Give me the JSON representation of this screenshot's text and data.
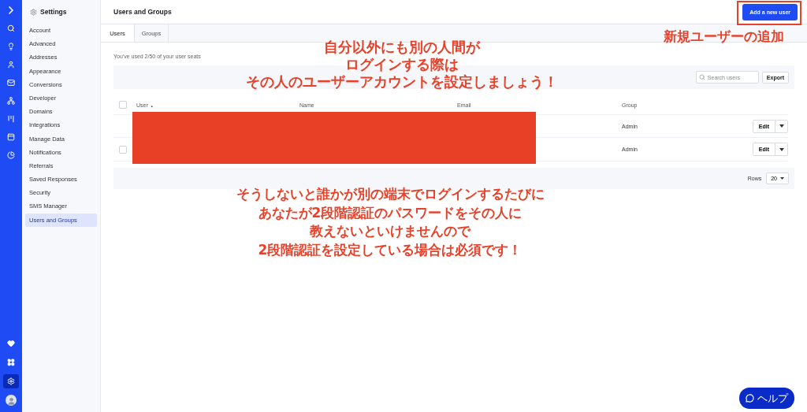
{
  "rail": {
    "icons": [
      {
        "kind": "logo"
      },
      {
        "kind": "search"
      },
      {
        "kind": "bulb"
      },
      {
        "kind": "person"
      },
      {
        "kind": "mail"
      },
      {
        "kind": "sitemap"
      },
      {
        "kind": "kanban"
      },
      {
        "kind": "window"
      },
      {
        "kind": "pie"
      }
    ],
    "bottom_icons": [
      {
        "kind": "heart",
        "selected": false
      },
      {
        "kind": "grid",
        "selected": false
      },
      {
        "kind": "gear",
        "selected": true
      },
      {
        "kind": "avatar",
        "selected": false
      }
    ]
  },
  "sidebar": {
    "title": "Settings",
    "items": [
      {
        "label": "Account",
        "selected": false
      },
      {
        "label": "Advanced",
        "selected": false
      },
      {
        "label": "Addresses",
        "selected": false
      },
      {
        "label": "Appearance",
        "selected": false
      },
      {
        "label": "Conversions",
        "selected": false
      },
      {
        "label": "Developer",
        "selected": false
      },
      {
        "label": "Domains",
        "selected": false
      },
      {
        "label": "Integrations",
        "selected": false
      },
      {
        "label": "Manage Data",
        "selected": false
      },
      {
        "label": "Notifications",
        "selected": false
      },
      {
        "label": "Referrals",
        "selected": false
      },
      {
        "label": "Saved Responses",
        "selected": false
      },
      {
        "label": "Security",
        "selected": false
      },
      {
        "label": "SMS Manager",
        "selected": false
      },
      {
        "label": "Users and Groups",
        "selected": true
      }
    ]
  },
  "header": {
    "title": "Users and Groups",
    "button": "Add a new user"
  },
  "tabs": [
    {
      "label": "Users",
      "selected": true
    },
    {
      "label": "Groups",
      "selected": false
    }
  ],
  "seats": "You've used 2/50 of your user seats",
  "toolbar": {
    "search": {
      "placeholder": "Search users"
    },
    "button": "Export"
  },
  "table": {
    "columns": [
      "User",
      "Name",
      "Email",
      "Group"
    ],
    "sort_arrow": "▲",
    "all_checked": false,
    "rows": [
      {
        "group": "Admin",
        "action": "Edit"
      },
      {
        "checked": false,
        "group": "Admin",
        "action": "Edit"
      }
    ]
  },
  "footer": {
    "label": "Rows",
    "value": "20"
  },
  "help": "ヘルプ",
  "annotations": {
    "top": [
      "自分以外にも別の人間が",
      "ログインする際は",
      "その人のユーザーアカウントを設定しましょう！"
    ],
    "button_note": "新規ユーザーの追加",
    "bottom": [
      "そうしないと誰かが別の端末でログインするたびに",
      "あなたが2段階認証のパスワードをその人に",
      "教えないといけませんので",
      "2段階認証を設定している場合は必須です！"
    ]
  }
}
